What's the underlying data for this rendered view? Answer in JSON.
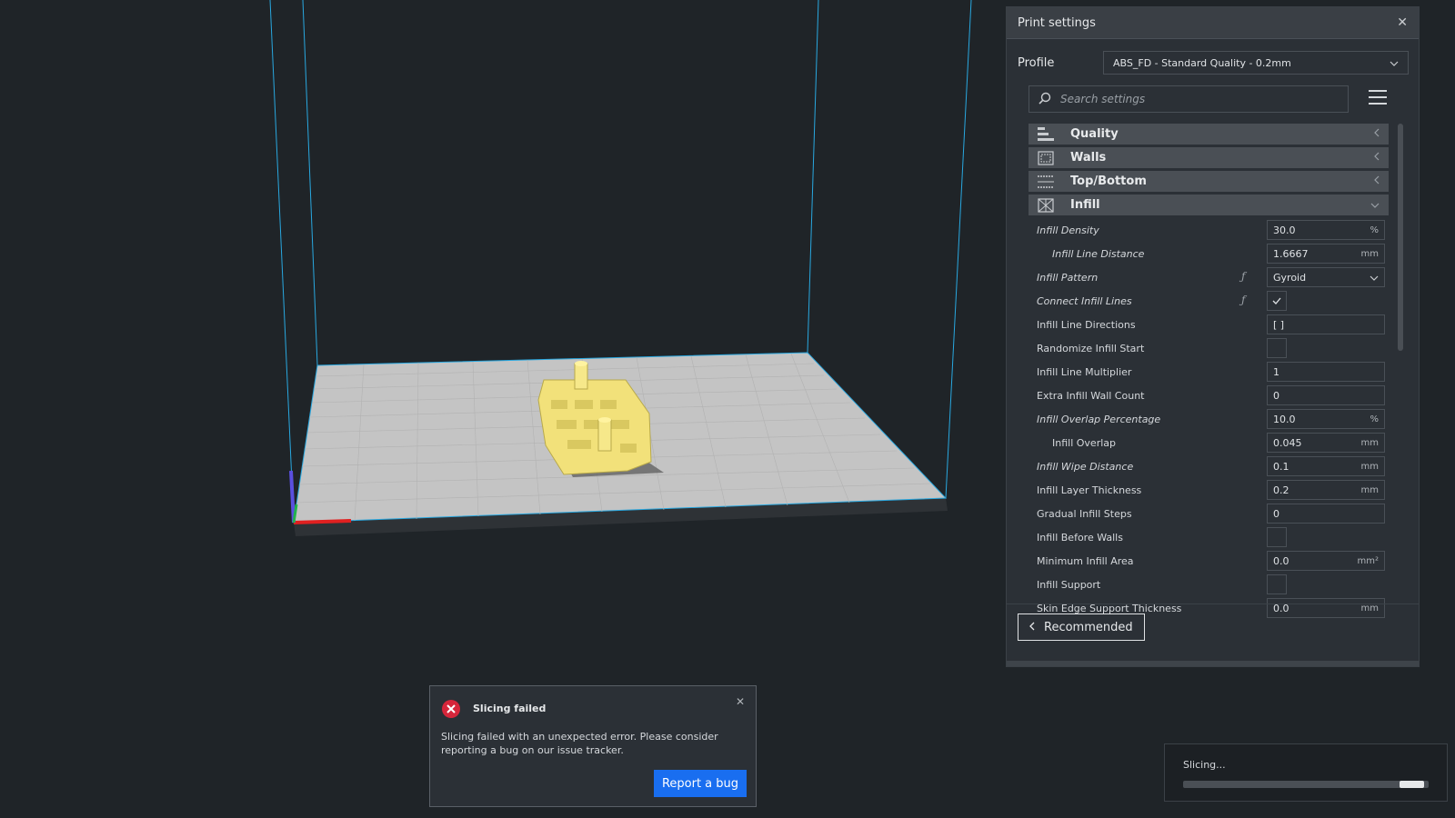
{
  "panel": {
    "title": "Print settings",
    "close_symbol": "✕",
    "profile_label": "Profile",
    "profile_value": "ABS_FD - Standard Quality - 0.2mm",
    "search_placeholder": "Search settings",
    "categories": [
      {
        "label": "Quality",
        "icon": "quality-icon",
        "state": "collapsed"
      },
      {
        "label": "Walls",
        "icon": "walls-icon",
        "state": "collapsed"
      },
      {
        "label": "Top/Bottom",
        "icon": "top-bottom-icon",
        "state": "collapsed"
      },
      {
        "label": "Infill",
        "icon": "infill-icon",
        "state": "expanded"
      }
    ],
    "settings": [
      {
        "label": "Infill Density",
        "type": "number",
        "value": "30.0",
        "unit": "%",
        "italic": true
      },
      {
        "label": "Infill Line Distance",
        "type": "number",
        "value": "1.6667",
        "unit": "mm",
        "italic": true,
        "child": true
      },
      {
        "label": "Infill Pattern",
        "type": "select",
        "value": "Gyroid",
        "italic": true,
        "fx": true
      },
      {
        "label": "Connect Infill Lines",
        "type": "checkbox",
        "checked": true,
        "italic": true,
        "fx": true
      },
      {
        "label": "Infill Line Directions",
        "type": "text",
        "value": "[ ]"
      },
      {
        "label": "Randomize Infill Start",
        "type": "checkbox",
        "checked": false
      },
      {
        "label": "Infill Line Multiplier",
        "type": "number",
        "value": "1"
      },
      {
        "label": "Extra Infill Wall Count",
        "type": "number",
        "value": "0"
      },
      {
        "label": "Infill Overlap Percentage",
        "type": "number",
        "value": "10.0",
        "unit": "%",
        "italic": true
      },
      {
        "label": "Infill Overlap",
        "type": "number",
        "value": "0.045",
        "unit": "mm",
        "child": true
      },
      {
        "label": "Infill Wipe Distance",
        "type": "number",
        "value": "0.1",
        "unit": "mm",
        "italic": true
      },
      {
        "label": "Infill Layer Thickness",
        "type": "number",
        "value": "0.2",
        "unit": "mm"
      },
      {
        "label": "Gradual Infill Steps",
        "type": "number",
        "value": "0"
      },
      {
        "label": "Infill Before Walls",
        "type": "checkbox",
        "checked": false
      },
      {
        "label": "Minimum Infill Area",
        "type": "number",
        "value": "0.0",
        "unit": "mm²"
      },
      {
        "label": "Infill Support",
        "type": "checkbox",
        "checked": false
      },
      {
        "label": "Skin Edge Support Thickness",
        "type": "number",
        "value": "0.0",
        "unit": "mm"
      }
    ],
    "recommended_label": "Recommended"
  },
  "error": {
    "title": "Slicing failed",
    "message": "Slicing failed with an unexpected error. Please consider reporting a bug on our issue tracker.",
    "button_label": "Report a bug",
    "close_symbol": "✕"
  },
  "slicing": {
    "label": "Slicing...",
    "progress_start": 0.88,
    "progress_end": 0.98
  },
  "colors": {
    "build_volume_lines": "#29a8e0",
    "model": "#f2e17a",
    "bed": "#c9c9c9",
    "accent_button": "#196ef0",
    "error_red": "#d6263b"
  }
}
